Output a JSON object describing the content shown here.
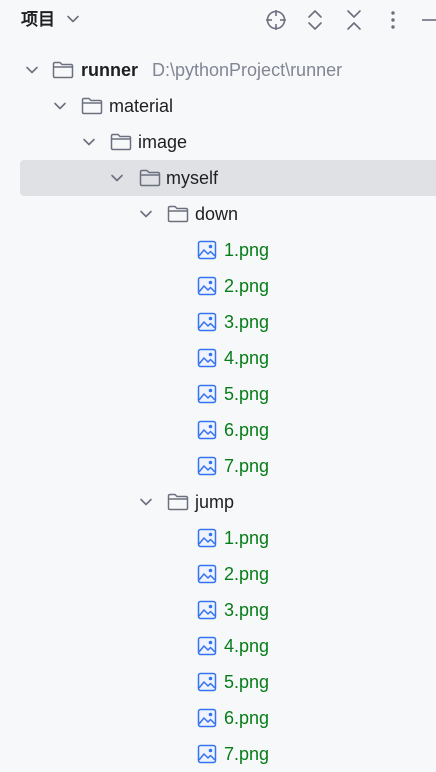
{
  "header": {
    "title": "项目",
    "icons": [
      "target-icon",
      "expand-icon",
      "collapse-icon",
      "more-icon",
      "minimize-icon"
    ]
  },
  "tree": {
    "root": {
      "label": "runner",
      "path": "D:\\pythonProject\\runner"
    },
    "material": "material",
    "image": "image",
    "myself": "myself",
    "down": {
      "label": "down",
      "files": [
        "1.png",
        "2.png",
        "3.png",
        "4.png",
        "5.png",
        "6.png",
        "7.png"
      ]
    },
    "jump": {
      "label": "jump",
      "files": [
        "1.png",
        "2.png",
        "3.png",
        "4.png",
        "5.png",
        "6.png",
        "7.png"
      ]
    }
  },
  "colors": {
    "file_text": "#067d17",
    "selected_row": "#dfe1e5",
    "image_icon": "#3574f0"
  }
}
